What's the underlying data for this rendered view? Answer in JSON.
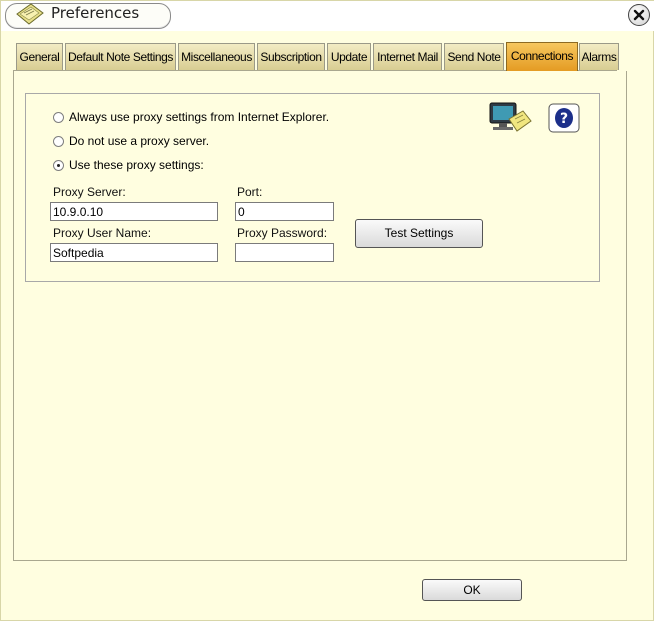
{
  "window": {
    "title": "Preferences"
  },
  "tabs": [
    {
      "label": "General",
      "active": false
    },
    {
      "label": "Default Note Settings",
      "active": false
    },
    {
      "label": "Miscellaneous",
      "active": false
    },
    {
      "label": "Subscription",
      "active": false
    },
    {
      "label": "Update",
      "active": false
    },
    {
      "label": "Internet Mail",
      "active": false
    },
    {
      "label": "Send Note",
      "active": false
    },
    {
      "label": "Connections",
      "active": true
    },
    {
      "label": "Alarms",
      "active": false
    }
  ],
  "connections": {
    "proxy_options": [
      {
        "label": "Always use proxy settings from Internet Explorer.",
        "selected": false
      },
      {
        "label": "Do not use a proxy server.",
        "selected": false
      },
      {
        "label": "Use these proxy settings:",
        "selected": true
      }
    ],
    "proxy_server_label": "Proxy Server:",
    "proxy_server_value": "10.9.0.10",
    "port_label": "Port:",
    "port_value": "0",
    "proxy_user_label": "Proxy User Name:",
    "proxy_user_value": "Softpedia",
    "proxy_password_label": "Proxy Password:",
    "proxy_password_value": "",
    "test_button_label": "Test Settings",
    "icons": [
      "network-notes-icon",
      "help-icon"
    ]
  },
  "footer": {
    "ok_label": "OK"
  },
  "colors": {
    "window_bg": "#fffee0",
    "tab_bg": "#e6dca8",
    "tab_active_bg": "#f0b040"
  }
}
